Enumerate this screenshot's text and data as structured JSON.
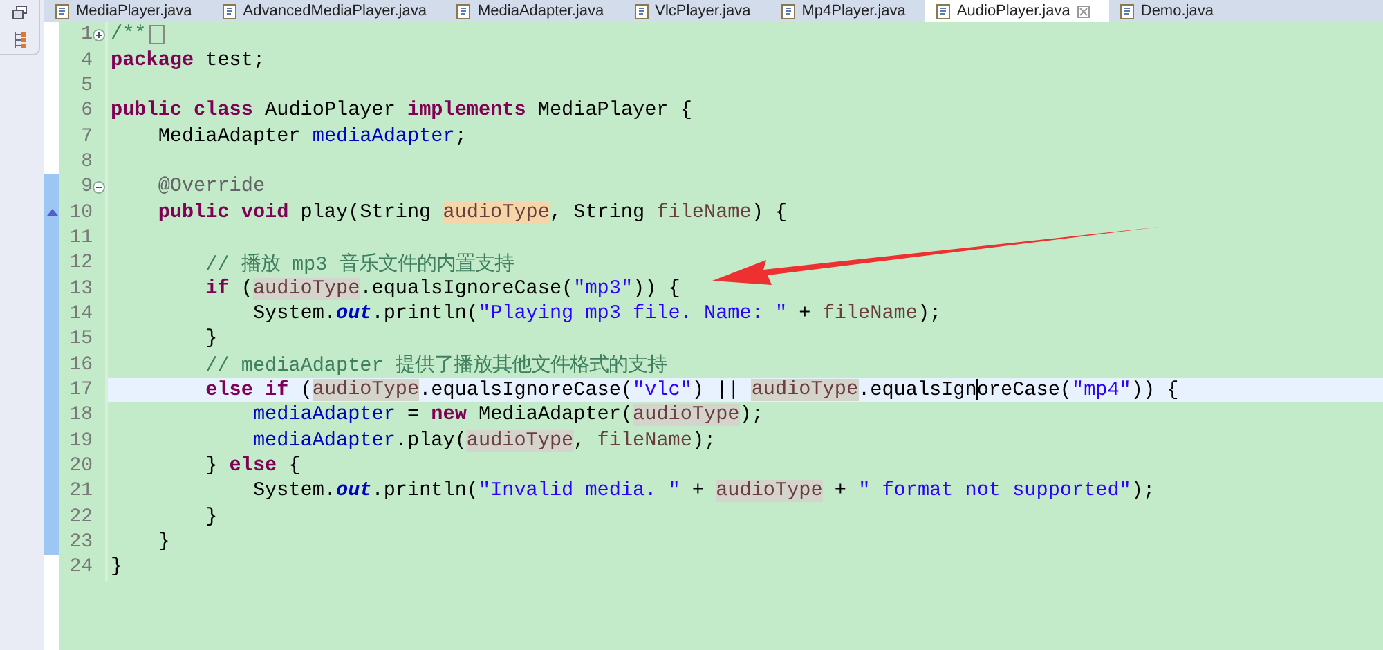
{
  "tabs": [
    {
      "label": "MediaPlayer.java",
      "selected": false
    },
    {
      "label": "AdvancedMediaPlayer.java",
      "selected": false
    },
    {
      "label": "MediaAdapter.java",
      "selected": false
    },
    {
      "label": "VlcPlayer.java",
      "selected": false
    },
    {
      "label": "Mp4Player.java",
      "selected": false
    },
    {
      "label": "AudioPlayer.java",
      "selected": true
    },
    {
      "label": "Demo.java",
      "selected": false
    }
  ],
  "lines": [
    {
      "num": "1",
      "expanded": false,
      "changed": false,
      "current": false,
      "tokens": [
        {
          "text": "/**",
          "kind": "comment"
        }
      ]
    },
    {
      "num": "4",
      "changed": false,
      "current": false,
      "tokens": [
        {
          "text": "package",
          "kind": "keyword"
        },
        {
          "text": " test;",
          "kind": "plain"
        }
      ]
    },
    {
      "num": "5",
      "changed": false,
      "current": false
    },
    {
      "num": "6",
      "changed": false,
      "current": false,
      "tokens": [
        {
          "text": "public class",
          "kind": "keyword"
        },
        {
          "text": " AudioPlayer ",
          "kind": "plain"
        },
        {
          "text": "implements",
          "kind": "keyword"
        },
        {
          "text": " MediaPlayer {",
          "kind": "plain"
        }
      ]
    },
    {
      "num": "7",
      "changed": false,
      "current": false,
      "tokens": [
        {
          "text": "    MediaAdapter ",
          "kind": "plain"
        },
        {
          "text": "mediaAdapter",
          "kind": "field"
        },
        {
          "text": ";",
          "kind": "plain"
        }
      ]
    },
    {
      "num": "8",
      "changed": false,
      "current": false
    },
    {
      "num": "9",
      "expanded": true,
      "changed": true,
      "current": false,
      "tokens": [
        {
          "text": "    @Override",
          "kind": "annotation"
        }
      ]
    },
    {
      "num": "10",
      "override": true,
      "changed": true,
      "current": false,
      "tokens": [
        {
          "text": "    public void",
          "kind": "keyword"
        },
        {
          "text": " play(String ",
          "kind": "plain"
        },
        {
          "text": "audioType",
          "kind": "param"
        },
        {
          "text": ", String ",
          "kind": "plain"
        },
        {
          "text": "fileName",
          "kind": "local"
        },
        {
          "text": ") {",
          "kind": "plain"
        }
      ]
    },
    {
      "num": "11",
      "changed": true,
      "current": false
    },
    {
      "num": "12",
      "changed": true,
      "current": false,
      "tokens": [
        {
          "text": "        // 播放 mp3 音乐文件的内置支持",
          "kind": "comment"
        }
      ]
    },
    {
      "num": "13",
      "changed": true,
      "current": false,
      "tokens": [
        {
          "text": "        if",
          "kind": "keyword"
        },
        {
          "text": " (",
          "kind": "plain"
        },
        {
          "text": "audioType",
          "kind": "occurrence"
        },
        {
          "text": ".equalsIgnoreCase(",
          "kind": "plain"
        },
        {
          "text": "\"mp3\"",
          "kind": "string"
        },
        {
          "text": ")) {",
          "kind": "plain"
        }
      ]
    },
    {
      "num": "14",
      "changed": true,
      "current": false,
      "tokens": [
        {
          "text": "            System.",
          "kind": "plain"
        },
        {
          "text": "out",
          "kind": "static"
        },
        {
          "text": ".println(",
          "kind": "plain"
        },
        {
          "text": "\"Playing mp3 file. Name: \"",
          "kind": "string"
        },
        {
          "text": " + ",
          "kind": "plain"
        },
        {
          "text": "fileName",
          "kind": "local"
        },
        {
          "text": ");",
          "kind": "plain"
        }
      ]
    },
    {
      "num": "15",
      "changed": true,
      "current": false,
      "tokens": [
        {
          "text": "        }",
          "kind": "plain"
        }
      ]
    },
    {
      "num": "16",
      "changed": true,
      "current": false,
      "tokens": [
        {
          "text": "        // mediaAdapter 提供了播放其他文件格式的支持",
          "kind": "comment"
        }
      ]
    },
    {
      "num": "17",
      "changed": true,
      "current": true,
      "tokens": [
        {
          "text": "        else if",
          "kind": "keyword"
        },
        {
          "text": " (",
          "kind": "plain"
        },
        {
          "text": "audioType",
          "kind": "occurrence"
        },
        {
          "text": ".equalsIgnoreCase(",
          "kind": "plain"
        },
        {
          "text": "\"vlc\"",
          "kind": "string"
        },
        {
          "text": ") || ",
          "kind": "plain"
        },
        {
          "text": "audioType",
          "kind": "occurrence"
        },
        {
          "text": ".equalsIgn",
          "kind": "plain",
          "caret": true
        },
        {
          "text": "oreCase(",
          "kind": "plain"
        },
        {
          "text": "\"mp4\"",
          "kind": "string"
        },
        {
          "text": ")) {",
          "kind": "plain"
        }
      ]
    },
    {
      "num": "18",
      "changed": true,
      "current": false,
      "tokens": [
        {
          "text": "            mediaAdapter",
          "kind": "field"
        },
        {
          "text": " = ",
          "kind": "plain"
        },
        {
          "text": "new",
          "kind": "keyword"
        },
        {
          "text": " MediaAdapter(",
          "kind": "plain"
        },
        {
          "text": "audioType",
          "kind": "occurrence"
        },
        {
          "text": ");",
          "kind": "plain"
        }
      ]
    },
    {
      "num": "19",
      "changed": true,
      "current": false,
      "tokens": [
        {
          "text": "            mediaAdapter",
          "kind": "field"
        },
        {
          "text": ".play(",
          "kind": "plain"
        },
        {
          "text": "audioType",
          "kind": "occurrence"
        },
        {
          "text": ", ",
          "kind": "plain"
        },
        {
          "text": "fileName",
          "kind": "local"
        },
        {
          "text": ");",
          "kind": "plain"
        }
      ]
    },
    {
      "num": "20",
      "changed": true,
      "current": false,
      "tokens": [
        {
          "text": "        } ",
          "kind": "plain"
        },
        {
          "text": "else",
          "kind": "keyword"
        },
        {
          "text": " {",
          "kind": "plain"
        }
      ]
    },
    {
      "num": "21",
      "changed": true,
      "current": false,
      "tokens": [
        {
          "text": "            System.",
          "kind": "plain"
        },
        {
          "text": "out",
          "kind": "static"
        },
        {
          "text": ".println(",
          "kind": "plain"
        },
        {
          "text": "\"Invalid media. \"",
          "kind": "string"
        },
        {
          "text": " + ",
          "kind": "plain"
        },
        {
          "text": "audioType",
          "kind": "occurrence"
        },
        {
          "text": " + ",
          "kind": "plain"
        },
        {
          "text": "\" format not supported\"",
          "kind": "string"
        },
        {
          "text": ");",
          "kind": "plain"
        }
      ]
    },
    {
      "num": "22",
      "changed": true,
      "current": false,
      "tokens": [
        {
          "text": "        }",
          "kind": "plain"
        }
      ]
    },
    {
      "num": "23",
      "changed": true,
      "current": false,
      "tokens": [
        {
          "text": "    }",
          "kind": "plain"
        }
      ]
    },
    {
      "num": "24",
      "changed": false,
      "current": false,
      "tokens": [
        {
          "text": "}",
          "kind": "plain"
        }
      ]
    }
  ]
}
